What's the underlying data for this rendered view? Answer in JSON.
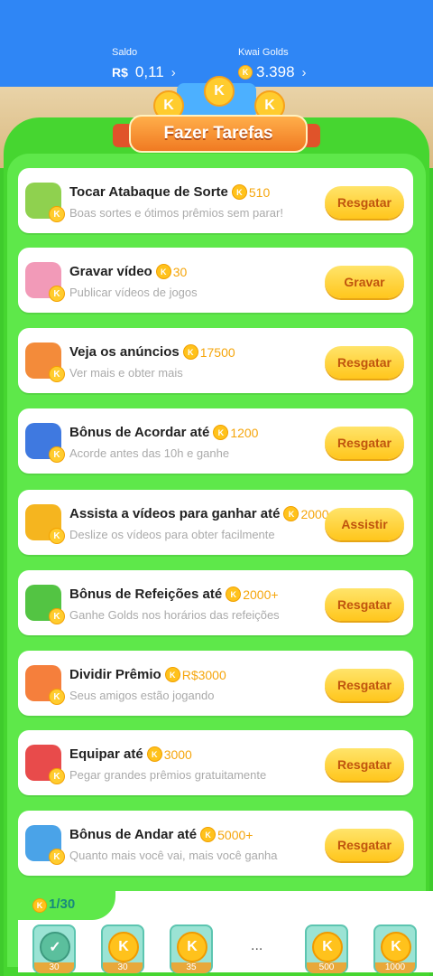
{
  "header": {
    "saldo_label": "Saldo",
    "saldo_currency": "R$",
    "saldo_value": "0,11",
    "golds_label": "Kwai Golds",
    "golds_value": "3.398",
    "chevron": "›",
    "coin_letter": "K"
  },
  "banner": {
    "title": "Fazer Tarefas"
  },
  "tasks": [
    {
      "title": "Tocar Atabaque de Sorte",
      "amount": "510",
      "subtitle": "Boas sortes e ótimos prêmios sem parar!",
      "button": "Resgatar",
      "icon": "drum-icon"
    },
    {
      "title": "Gravar vídeo",
      "amount": "30",
      "subtitle": "Publicar vídeos de jogos",
      "button": "Gravar",
      "icon": "camera-icon"
    },
    {
      "title": "Veja os anúncios",
      "amount": "17500",
      "subtitle": "Ver mais e obter mais",
      "button": "Resgatar",
      "icon": "tv-icon"
    },
    {
      "title": "Bônus de Acordar até",
      "amount": "1200",
      "subtitle": "Acorde antes das 10h e ganhe",
      "button": "Resgatar",
      "icon": "moon-icon"
    },
    {
      "title": "Assista a vídeos para ganhar até",
      "amount": "2000",
      "subtitle": "Deslize os vídeos para obter facilmente",
      "button": "Assistir",
      "icon": "video-camera-icon"
    },
    {
      "title": "Bônus de Refeições até",
      "amount": "2000+",
      "subtitle": "Ganhe Golds nos horários das refeições",
      "button": "Resgatar",
      "icon": "calendar-icon"
    },
    {
      "title": "Dividir Prêmio",
      "amount": "R$3000",
      "subtitle": "Seus amigos estão jogando",
      "button": "Resgatar",
      "icon": "gift-icon"
    },
    {
      "title": "Equipar até",
      "amount": "3000",
      "subtitle": "Pegar grandes prêmios gratuitamente",
      "button": "Resgatar",
      "icon": "boxing-gloves-icon"
    },
    {
      "title": "Bônus de Andar até",
      "amount": "5000+",
      "subtitle": "Quanto mais você vai, mais você ganha",
      "button": "Resgatar",
      "icon": "runner-icon"
    }
  ],
  "checkin": {
    "progress": "1/30",
    "ellipsis": "...",
    "days": [
      {
        "value": "30",
        "done": true
      },
      {
        "value": "30",
        "done": false
      },
      {
        "value": "35",
        "done": false
      },
      {
        "value": "500",
        "done": false
      },
      {
        "value": "1000",
        "done": false
      }
    ]
  }
}
